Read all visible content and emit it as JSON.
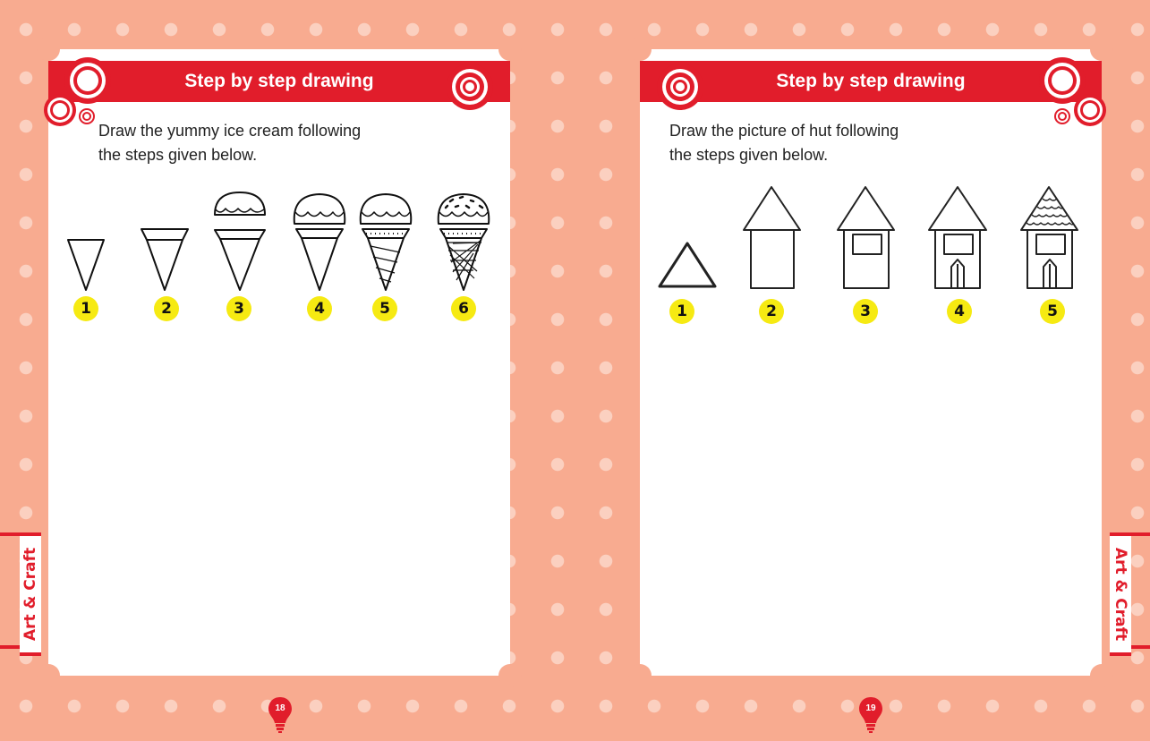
{
  "left_page": {
    "title": "Step by step drawing",
    "instructions": [
      "Draw the yummy ice cream following",
      "the steps given below."
    ],
    "steps": [
      "1",
      "2",
      "3",
      "4",
      "5",
      "6"
    ],
    "page_number": "18"
  },
  "right_page": {
    "title": "Step by step drawing",
    "instructions": [
      "Draw the picture of hut following",
      "the steps given below."
    ],
    "steps": [
      "1",
      "2",
      "3",
      "4",
      "5"
    ],
    "page_number": "19"
  },
  "side_tab": "Art & Craft",
  "colors": {
    "accent": "#e11d2b",
    "background": "#f8ab90",
    "badge": "#f6ea12"
  }
}
